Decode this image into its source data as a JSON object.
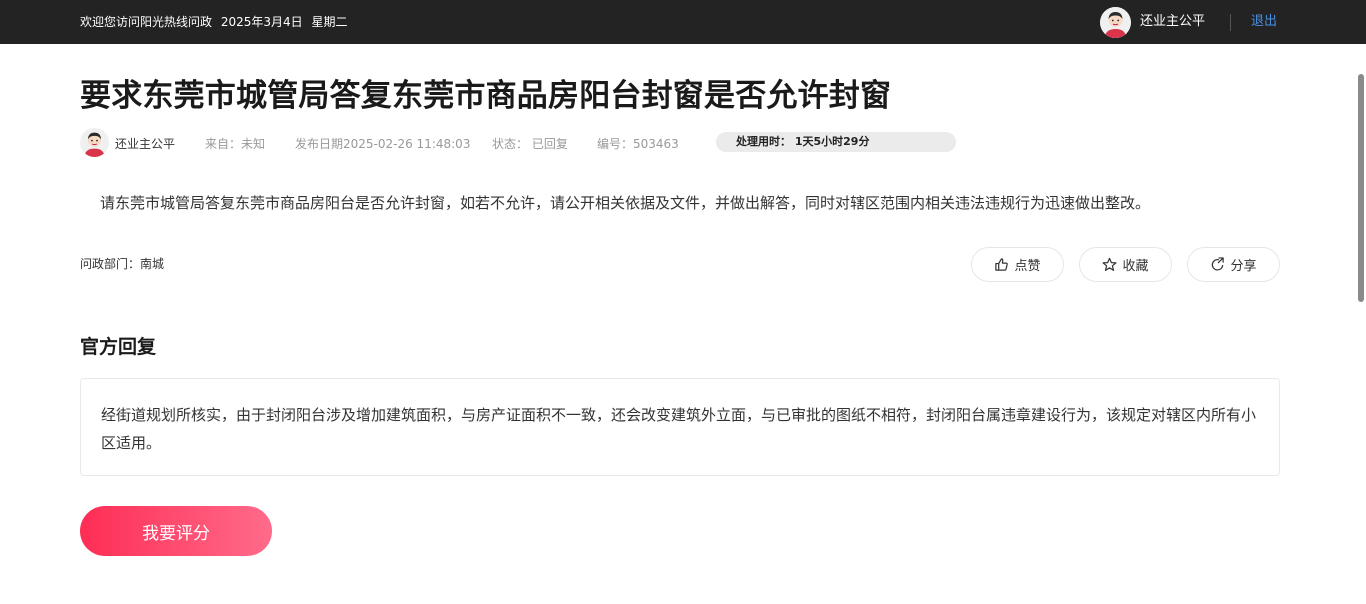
{
  "topbar": {
    "welcome": "欢迎您访问阳光热线问政",
    "date": "2025年3月4日",
    "weekday": "星期二",
    "username": "还业主公平",
    "logout": "退出"
  },
  "article": {
    "title": "要求东莞市城管局答复东莞市商品房阳台封窗是否允许封窗",
    "author": "还业主公平",
    "source": "来自：未知",
    "publish_date": "发布日期2025-02-26 11:48:03",
    "status": "状态： 已回复",
    "number": "编号：503463",
    "processing_time": "处理用时： 1天5小时29分",
    "content": "请东莞市城管局答复东莞市商品房阳台是否允许封窗，如若不允许，请公开相关依据及文件，并做出解答，同时对辖区范围内相关违法违规行为迅速做出整改。",
    "department": "问政部门：南城"
  },
  "actions": {
    "like": "点赞",
    "favorite": "收藏",
    "share": "分享"
  },
  "reply": {
    "section_title": "官方回复",
    "content": "经街道规划所核实，由于封闭阳台涉及增加建筑面积，与房产证面积不一致，还会改变建筑外立面，与已审批的图纸不相符，封闭阳台属违章建设行为，该规定对辖区内所有小区适用。"
  },
  "rate_button": "我要评分",
  "colors": {
    "topbar_bg": "#232323",
    "logout_link": "#4a90e2",
    "rate_gradient_start": "#fe2d55",
    "rate_gradient_end": "#ff6b8a"
  }
}
